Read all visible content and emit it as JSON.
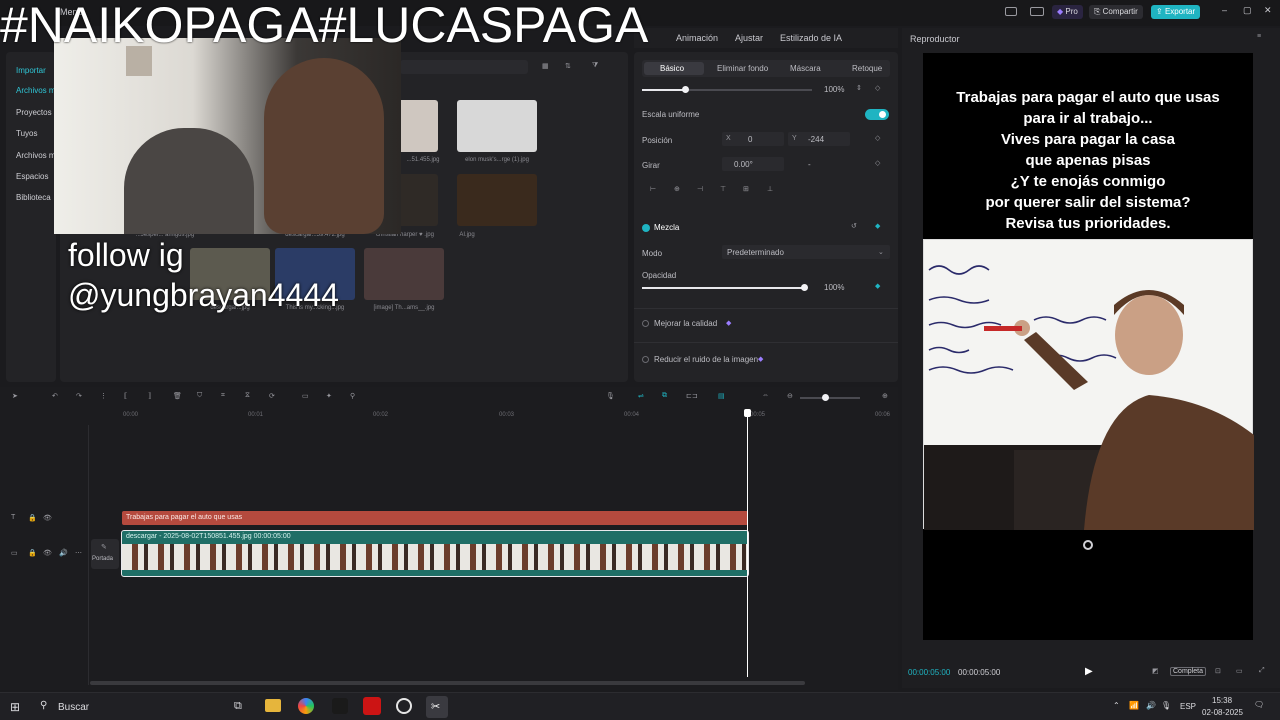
{
  "overlay": {
    "headline": "#NAIKOPAGA#LUCASPAGA",
    "follow_line1": "follow ig",
    "follow_line2": "@yungbrayan4444"
  },
  "titlebar": {
    "menu": "Menú",
    "pro": "Pro",
    "share": "Compartir",
    "export": "Exportar"
  },
  "top_tabs": [
    "Animación",
    "Ajustar",
    "Estilizado de IA"
  ],
  "player_title": "Reproductor",
  "sidebar": {
    "items": [
      "Importar",
      "Archivos m",
      "Proyectos",
      "Tuyos",
      "Archivos m",
      "Espacios",
      "Biblioteca"
    ]
  },
  "media": {
    "labels": [
      "...51.455.jpg",
      "elon musk's...rge (1).jpg",
      "christian harper ♥ .jpg",
      "AI.jpg",
      "descargar...jpg",
      "descargar...59.472.jpg",
      "descargar...jpg",
      "This is my...cking...jpg",
      "[image] Th...ams__.jpg",
      "...Jesper... amigos.jpg",
      "descargar...44.940.jpg"
    ]
  },
  "properties": {
    "sub_tabs": [
      "Básico",
      "Eliminar fondo",
      "Máscara",
      "Retoque"
    ],
    "scale_value": "100%",
    "uniform_scale": "Escala uniforme",
    "uniform_scale_on": 1,
    "position_label": "Posición",
    "pos_x_label": "X",
    "pos_x": "0",
    "pos_y_label": "Y",
    "pos_y": "-244",
    "rotate_label": "Girar",
    "rotate_value": "0.00°",
    "rotate_dash": "-",
    "blend_label": "Mezcla",
    "mode_label": "Modo",
    "mode_value": "Predeterminado",
    "opacity_label": "Opacidad",
    "opacity_value": "100%",
    "improve_quality": "Mejorar la calidad",
    "reduce_noise": "Reducir el ruido de la imagen",
    "scale_fraction": 0.25,
    "opacity_fraction": 1.0
  },
  "timeline": {
    "ruler": [
      "00:00",
      "00:01",
      "00:02",
      "00:03",
      "00:04",
      "00:05",
      "00:06"
    ],
    "text_clip": "Trabajas para pagar el auto que usas",
    "video_clip": "descargar - 2025-08-02T150851.455.jpg   00:00:05:00",
    "cover_label": "Portada",
    "playhead_fraction": 0.83
  },
  "video": {
    "caption_lines": [
      "Trabajas para pagar el auto que usas",
      "para ir al trabajo...",
      "Vives para pagar la casa",
      "que apenas pisas",
      "¿Y te enojás conmigo",
      "por querer salir del sistema?",
      "Revisa tus prioridades."
    ]
  },
  "player_controls": {
    "current_time": "00:00:05:00",
    "total_time": "00:00:05:00",
    "ratio": "Completa"
  },
  "taskbar": {
    "search": "Buscar",
    "lang": "ESP",
    "time": "15:38",
    "date": "02-08-2025"
  }
}
